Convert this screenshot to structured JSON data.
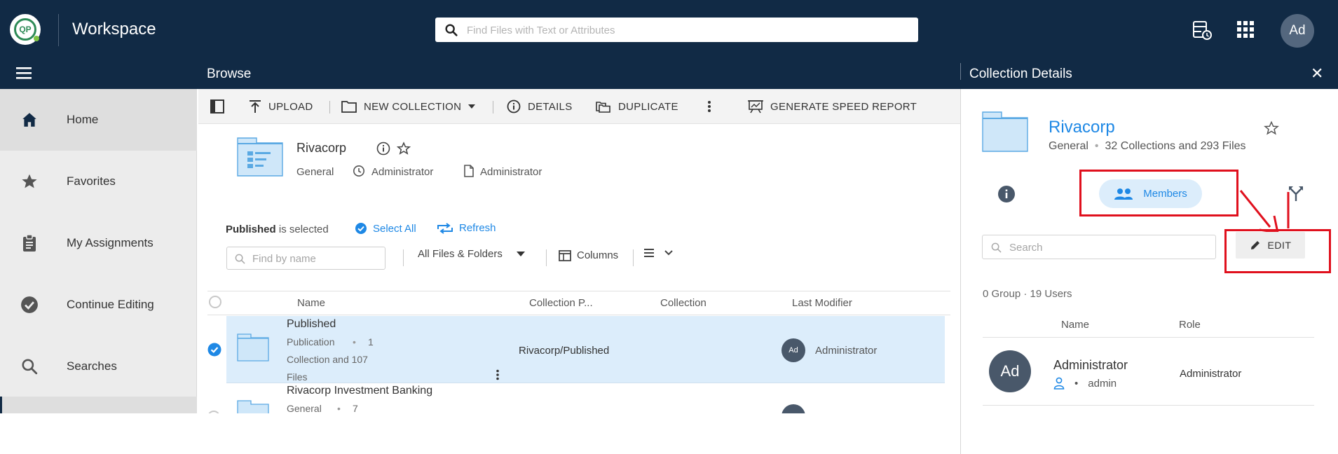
{
  "header": {
    "logo_text": "QP",
    "app_title": "Workspace",
    "search_placeholder": "Find Files with Text or Attributes",
    "avatar_initials": "Ad"
  },
  "subbar": {
    "browse_title": "Browse",
    "details_title": "Collection Details",
    "close_symbol": "✕"
  },
  "sidebar": {
    "items": [
      {
        "label": "Home",
        "icon": "home-icon"
      },
      {
        "label": "Favorites",
        "icon": "star-icon"
      },
      {
        "label": "My Assignments",
        "icon": "clipboard-icon"
      },
      {
        "label": "Continue Editing",
        "icon": "check-circle-icon"
      },
      {
        "label": "Searches",
        "icon": "search-icon"
      }
    ]
  },
  "toolbar": {
    "upload": "UPLOAD",
    "new_collection": "NEW COLLECTION",
    "details": "DETAILS",
    "duplicate": "DUPLICATE",
    "generate_report": "GENERATE SPEED REPORT"
  },
  "collection": {
    "name": "Rivacorp",
    "type": "General",
    "owner": "Administrator",
    "modifier": "Administrator"
  },
  "selection": {
    "selected_name": "Published",
    "selected_suffix": "is selected",
    "select_all": "Select All",
    "refresh": "Refresh"
  },
  "filters": {
    "find_placeholder": "Find by name",
    "filter_value": "All Files & Folders",
    "columns_label": "Columns"
  },
  "table": {
    "columns": [
      "Name",
      "Collection P...",
      "Collection",
      "Last Modifier"
    ],
    "rows": [
      {
        "name": "Published",
        "type": "Publication",
        "count_line1": "1",
        "count_line2": "Collection and 107",
        "count_line3": "Files",
        "path": "Rivacorp/Published",
        "modifier_initials": "Ad",
        "modifier": "Administrator"
      },
      {
        "name": "Rivacorp Investment Banking",
        "type": "General",
        "count_line1": "7"
      }
    ]
  },
  "details_panel": {
    "name": "Rivacorp",
    "type": "General",
    "summary": "32 Collections and 293 Files",
    "members_tab": "Members",
    "search_placeholder": "Search",
    "edit_label": "EDIT",
    "counts": "0 Group · 19 Users",
    "columns": [
      "Name",
      "Role"
    ],
    "members": [
      {
        "initials": "Ad",
        "name": "Administrator",
        "username": "admin",
        "role": "Administrator"
      }
    ]
  },
  "colors": {
    "header_bg": "#112a45",
    "accent": "#1e88e5",
    "selected_row": "#dcedfb",
    "highlight": "#e0101d"
  }
}
